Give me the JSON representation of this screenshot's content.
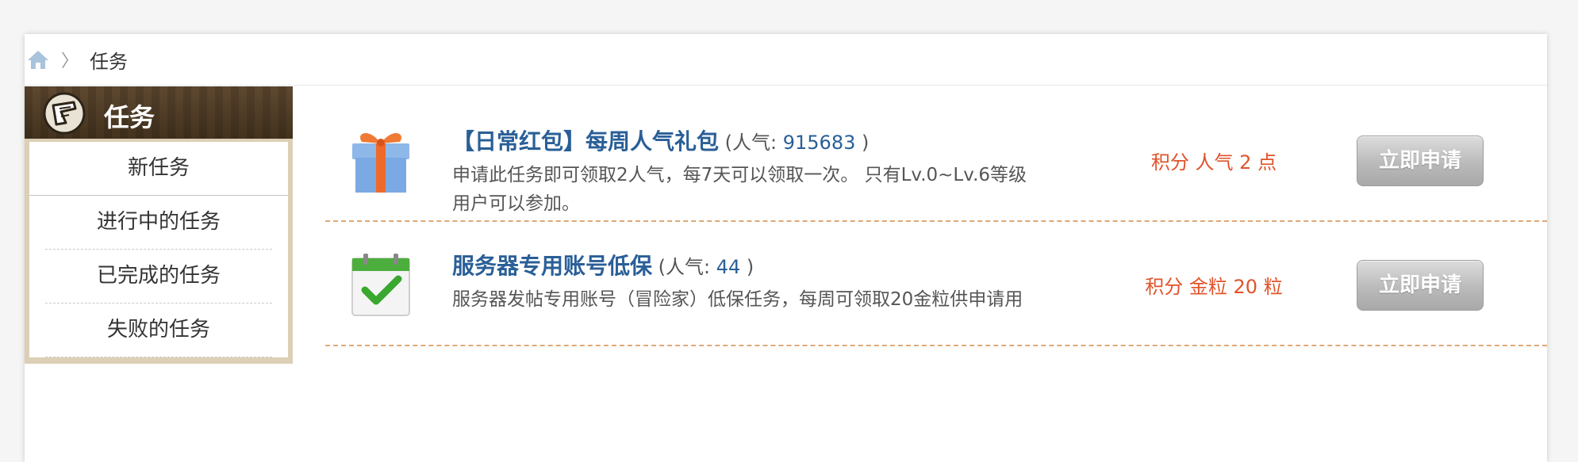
{
  "breadcrumb": {
    "home_icon": "home-icon",
    "separator": "〉",
    "current": "任务"
  },
  "sidebar": {
    "title": "任务",
    "icon": "task-scroll-icon",
    "items": [
      {
        "label": "新任务"
      },
      {
        "label": "进行中的任务"
      },
      {
        "label": "已完成的任务"
      },
      {
        "label": "失败的任务"
      }
    ]
  },
  "tasks": [
    {
      "icon": "gift-icon",
      "title": "【日常红包】每周人气礼包",
      "pop_prefix": " (人气: ",
      "pop_value": "915683",
      "pop_suffix": " )",
      "desc": "申请此任务即可领取2人气，每7天可以领取一次。 只有Lv.0~Lv.6等级用户可以参加。",
      "reward": "积分 人气 2 点",
      "button": "立即申请"
    },
    {
      "icon": "calendar-check-icon",
      "title": "服务器专用账号低保",
      "pop_prefix": " (人气: ",
      "pop_value": "44",
      "pop_suffix": " )",
      "desc": "服务器发帖专用账号（冒险家）低保任务，每周可领取20金粒供申请用",
      "reward": "积分 金粒 20 粒",
      "button": "立即申请"
    }
  ],
  "colors": {
    "link": "#2a5f97",
    "reward": "#e0532a",
    "divider": "#e0a878"
  }
}
